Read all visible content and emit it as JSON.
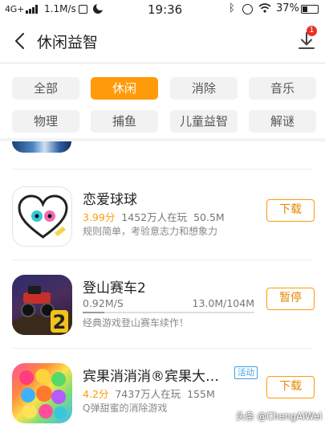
{
  "status_bar": {
    "network": "4G+",
    "speed": "1.1M/s",
    "time": "19:36",
    "battery": "37%"
  },
  "header": {
    "title": "休闲益智",
    "download_badge": "1"
  },
  "categories": {
    "items": [
      "全部",
      "休闲",
      "消除",
      "音乐",
      "物理",
      "捕鱼",
      "儿童益智",
      "解谜"
    ],
    "active": "休闲"
  },
  "apps": [
    {
      "name": "恋爱球球",
      "rating": "3.99分",
      "players": "1452万人在玩",
      "size": "50.5M",
      "description": "规则简单，考验意志力和想象力",
      "action": "下载"
    },
    {
      "name": "登山赛车2",
      "speed": "0.92M/S",
      "progress_text": "13.0M/104M",
      "progress": 0.125,
      "description": "经典游戏登山赛车续作！",
      "action": "暂停"
    },
    {
      "name": "宾果消消消®宾果大…",
      "tag": "活动",
      "rating": "4.2分",
      "players": "7437万人在玩",
      "size": "155M",
      "description": "Q弹甜蜜的消除游戏",
      "action": "下载"
    }
  ],
  "watermark": "头条 @ChengAiWei",
  "colors": {
    "accent": "#ff9a0b",
    "badge": "#e8312b",
    "tag": "#3fa0e6"
  }
}
